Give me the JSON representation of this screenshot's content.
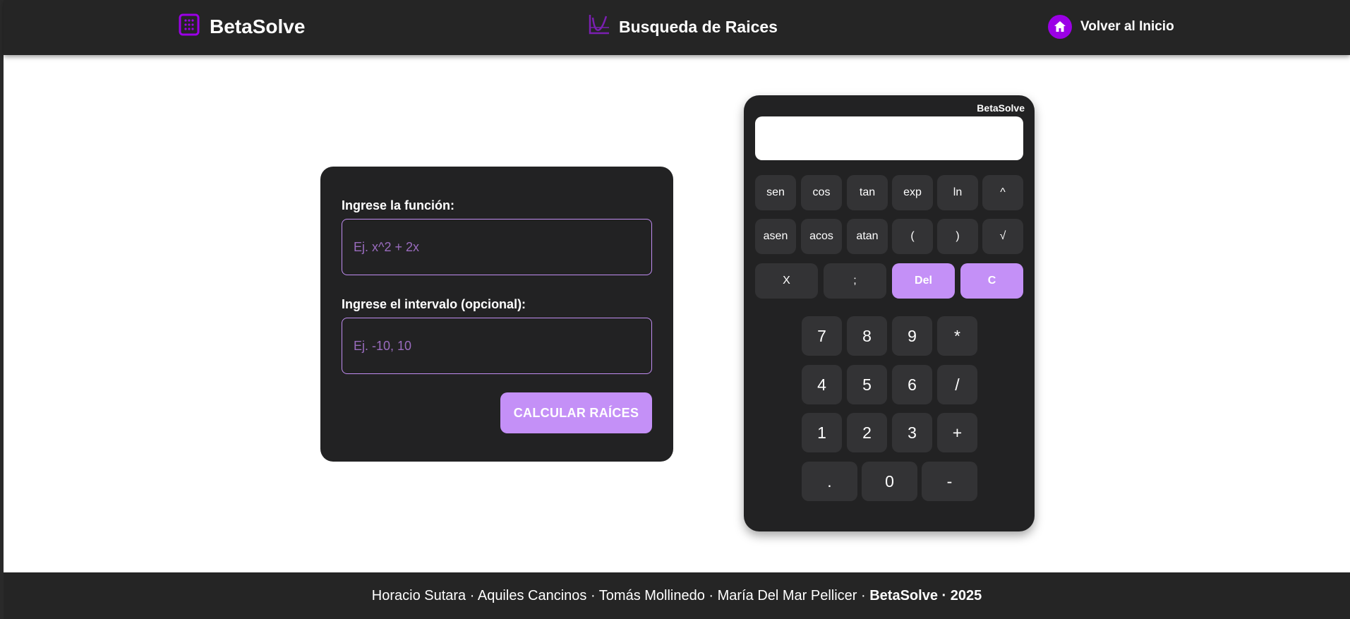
{
  "header": {
    "brand": "BetaSolve",
    "brand_icon": "calculator-grid-icon",
    "section_title": "Busqueda de Raices",
    "section_icon": "function-graph-icon",
    "home_link": "Volver al Inicio",
    "home_icon": "home-icon",
    "accent_color": "#9b00e6"
  },
  "form": {
    "function_label": "Ingrese la función:",
    "function_placeholder": "Ej. x^2 + 2x",
    "function_value": "",
    "interval_label": "Ingrese el intervalo (opcional):",
    "interval_placeholder": "Ej. -10, 10",
    "interval_value": "",
    "submit_label": "CALCULAR RAÍCES"
  },
  "calculator": {
    "brand": "BetaSolve",
    "display_value": "",
    "row1": [
      "sen",
      "cos",
      "tan",
      "exp",
      "ln",
      "^"
    ],
    "row2": [
      "asen",
      "acos",
      "atan",
      "(",
      ")",
      "√"
    ],
    "row3": [
      "X",
      ";",
      "Del",
      "C"
    ],
    "num_row1": [
      "7",
      "8",
      "9",
      "*"
    ],
    "num_row2": [
      "4",
      "5",
      "6",
      "/"
    ],
    "num_row3": [
      "1",
      "2",
      "3",
      "+"
    ],
    "num_row4": [
      ".",
      "0",
      "-"
    ],
    "accent_color": "#c490f7"
  },
  "footer": {
    "authors": "Horacio Sutara · Aquiles Cancinos · Tomás Mollinedo · María Del Mar Pellicer · ",
    "brand_year": "BetaSolve · 2025"
  }
}
